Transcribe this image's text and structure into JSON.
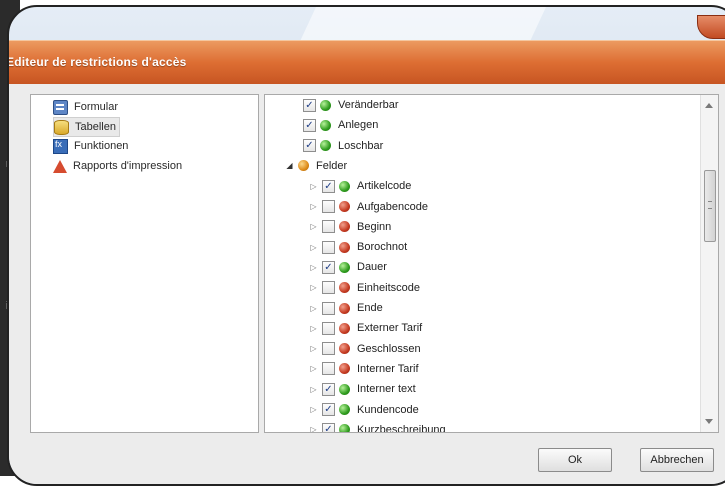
{
  "dialog": {
    "title": "Editeur de restrictions d'accès"
  },
  "sidebar": {
    "items": [
      {
        "label": "Formular",
        "icon": "form-icon"
      },
      {
        "label": "Tabellen",
        "icon": "table-icon",
        "selected": true
      },
      {
        "label": "Funktionen",
        "icon": "function-icon"
      },
      {
        "label": "Rapports d'impression",
        "icon": "report-icon"
      }
    ]
  },
  "tree": {
    "permissions": [
      {
        "label": "Veränderbar",
        "checked": true,
        "status": "green"
      },
      {
        "label": "Anlegen",
        "checked": true,
        "status": "green"
      },
      {
        "label": "Loschbar",
        "checked": true,
        "status": "green"
      }
    ],
    "group": {
      "label": "Felder",
      "status": "orange"
    },
    "fields": [
      {
        "label": "Artikelcode",
        "checked": true,
        "status": "green"
      },
      {
        "label": "Aufgabencode",
        "checked": false,
        "status": "red"
      },
      {
        "label": "Beginn",
        "checked": false,
        "status": "red"
      },
      {
        "label": "Borochnot",
        "checked": false,
        "status": "red"
      },
      {
        "label": "Dauer",
        "checked": true,
        "status": "green"
      },
      {
        "label": "Einheitscode",
        "checked": false,
        "status": "red"
      },
      {
        "label": "Ende",
        "checked": false,
        "status": "red"
      },
      {
        "label": "Externer Tarif",
        "checked": false,
        "status": "red"
      },
      {
        "label": "Geschlossen",
        "checked": false,
        "status": "red"
      },
      {
        "label": "Interner Tarif",
        "checked": false,
        "status": "red"
      },
      {
        "label": "Interner text",
        "checked": true,
        "status": "green"
      },
      {
        "label": "Kundencode",
        "checked": true,
        "status": "green"
      },
      {
        "label": "Kurzbeschreibung",
        "checked": true,
        "status": "green"
      }
    ]
  },
  "buttons": {
    "ok": "Ok",
    "cancel": "Abbrechen"
  },
  "background_fragments": [
    "r",
    "I-",
    "i"
  ]
}
